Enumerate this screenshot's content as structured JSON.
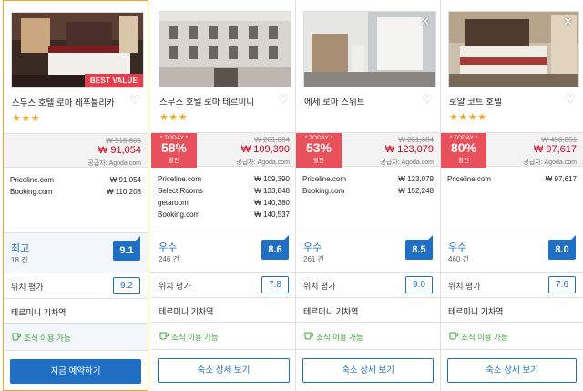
{
  "hotels": [
    {
      "name": "스무스 호텔 로마 레푸블리카",
      "stars": "★★★",
      "badge": "BEST VALUE",
      "deal": null,
      "old_price": "₩ 518,605",
      "new_price": "₩ 91,054",
      "supplier": "공급자: Agoda.com",
      "offers": [
        {
          "site": "Priceline.com",
          "price": "₩  91,054"
        },
        {
          "site": "Booking.com",
          "price": "₩ 110,208"
        }
      ],
      "rating_word": "최고",
      "rating_count": "18 건",
      "score": "9.1",
      "location_label": "위치 평가",
      "location_score": "9.2",
      "neighborhood": "테르미니 기차역",
      "breakfast": "조식 이용 가능",
      "button": "지금 예약하기",
      "primary": true,
      "selected": true
    },
    {
      "name": "스무스 호텔 로마 테르미니",
      "stars": "★★★",
      "badge": "",
      "deal": {
        "today": "* TODAY *",
        "pct": "58%",
        "label": "할인"
      },
      "old_price": "₩ 261,684",
      "new_price": "₩ 109,390",
      "supplier": "공급자: Agoda.com",
      "offers": [
        {
          "site": "Priceline.com",
          "price": "₩ 109,390"
        },
        {
          "site": "Select Rooms",
          "price": "₩ 133,848"
        },
        {
          "site": "getaroom",
          "price": "₩ 140,380"
        },
        {
          "site": "Booking.com",
          "price": "₩ 140,537"
        }
      ],
      "rating_word": "우수",
      "rating_count": "246 건",
      "score": "8.6",
      "location_label": "위치 평가",
      "location_score": "7.8",
      "neighborhood": "테르미니 기차역",
      "breakfast": "조식 이용 가능",
      "button": "숙소 상세 보기",
      "primary": false,
      "selected": false
    },
    {
      "name": "에세 로마 스위트",
      "stars": "",
      "badge": "",
      "deal": {
        "today": "* TODAY *",
        "pct": "53%",
        "label": "할인"
      },
      "old_price": "₩ 261,684",
      "new_price": "₩ 123,079",
      "supplier": "공급자: Agoda.com",
      "offers": [
        {
          "site": "Priceline.com",
          "price": "₩ 123,079"
        },
        {
          "site": "Booking.com",
          "price": "₩ 152,248"
        }
      ],
      "rating_word": "우수",
      "rating_count": "261 건",
      "score": "8.5",
      "location_label": "위치 평가",
      "location_score": "9.0",
      "neighborhood": "테르미니 기차역",
      "breakfast": "조식 이용 가능",
      "button": "숙소 상세 보기",
      "primary": false,
      "selected": false
    },
    {
      "name": "로얄 코트 호텔",
      "stars": "★★★★",
      "badge": "",
      "deal": {
        "today": "* TODAY *",
        "pct": "80%",
        "label": "할인"
      },
      "old_price": "₩ 498,351",
      "new_price": "₩ 97,617",
      "supplier": "공급자: Agoda.com",
      "offers": [
        {
          "site": "Priceline.com",
          "price": "₩  97,617"
        }
      ],
      "rating_word": "우수",
      "rating_count": "460 건",
      "score": "8.0",
      "location_label": "위치 평가",
      "location_score": "7.6",
      "neighborhood": "테르미니 기차역",
      "breakfast": "조식 이용 가능",
      "button": "숙소 상세 보기",
      "primary": false,
      "selected": false
    }
  ],
  "icons": {
    "favorite": "heart-outline-icon",
    "close": "close-icon",
    "breakfast": "coffee-cup-icon"
  },
  "colors": {
    "accent": "#1f6fc5",
    "deal": "#e8505b",
    "price": "#d0021b",
    "stars": "#f5a623",
    "breakfast": "#3aaa35",
    "selection": "#f5a623"
  }
}
